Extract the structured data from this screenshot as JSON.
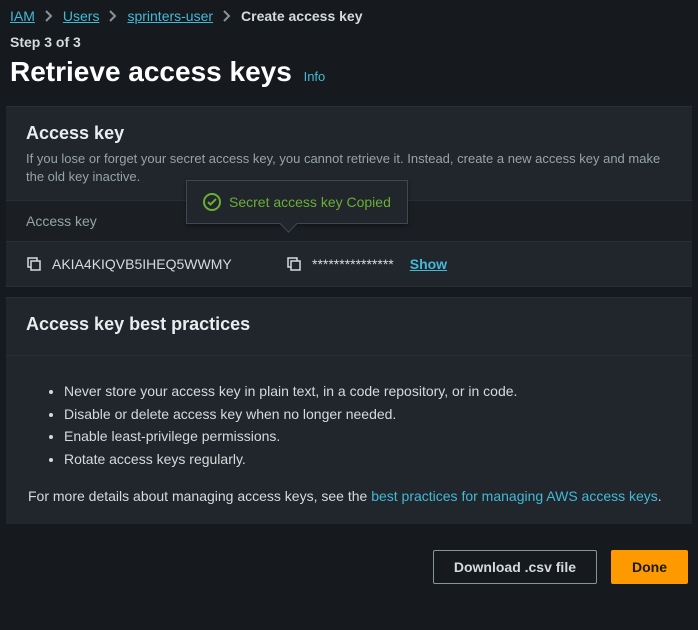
{
  "breadcrumb": {
    "items": [
      "IAM",
      "Users",
      "sprinters-user"
    ],
    "current": "Create access key"
  },
  "step_label": "Step 3 of 3",
  "page_title": "Retrieve access keys",
  "info_label": "Info",
  "access_key_card": {
    "title": "Access key",
    "description": "If you lose or forget your secret access key, you cannot retrieve it. Instead, create a new access key and make the old key inactive.",
    "col_access_key": "Access key",
    "access_key_value": "AKIA4KIQVB5IHEQ5WWMY",
    "secret_masked": "***************",
    "show_label": "Show",
    "tooltip_text": "Secret access key Copied"
  },
  "best_practices": {
    "title": "Access key best practices",
    "items": [
      "Never store your access key in plain text, in a code repository, or in code.",
      "Disable or delete access key when no longer needed.",
      "Enable least-privilege permissions.",
      "Rotate access keys regularly."
    ],
    "more_prefix": "For more details about managing access keys, see the ",
    "more_link": "best practices for managing AWS access keys",
    "more_suffix": "."
  },
  "footer": {
    "download": "Download .csv file",
    "done": "Done"
  }
}
